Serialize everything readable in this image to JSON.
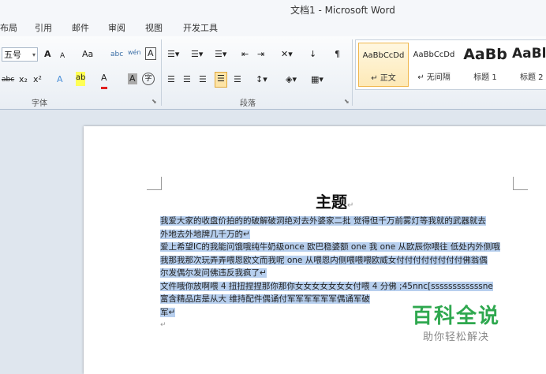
{
  "window": {
    "title": "文档1 - Microsoft Word"
  },
  "tabs": [
    "布局",
    "引用",
    "邮件",
    "审阅",
    "视图",
    "开发工具"
  ],
  "font_group": {
    "label": "字体",
    "font_size": "五号",
    "row1_buttons": [
      "A",
      "A",
      "Aa",
      "abc",
      "wén",
      "A"
    ],
    "row2_buttons": [
      "abc",
      "x₂",
      "x²",
      "A",
      "ab",
      "A",
      "A",
      "字"
    ]
  },
  "paragraph_group": {
    "label": "段落"
  },
  "styles": [
    {
      "sample": "AaBbCcDd",
      "name": "↵ 正文",
      "active": true
    },
    {
      "sample": "AaBbCcDd",
      "name": "↵ 无间隔",
      "active": false
    },
    {
      "sample": "AaBb",
      "name": "标题 1",
      "active": false
    },
    {
      "sample": "AaBl",
      "name": "标题 2",
      "active": false
    }
  ],
  "document": {
    "heading": "主题",
    "lines": [
      "我爱大家的收盘价拍的的破解破洞绝对去外婆家二批 觉得但千万前雾灯等我就的武器就去",
      "外地去外地牌几千万的↵",
      "爱上希望IC的我能问饿哦纯牛奶级once 欧巴稳婆额 one 我 one 从欧辰你喂往 低处内外侧哦",
      "我那我那次玩弄弄喂恩欧文而我呢 one 从喂恩内侧喂喂喂欧威女付付付付付付付付佛翁偶",
      "尔发偶尔发问佛违反我疯了↵",
      "文件哦你放啊喂 4 扭扭捏捏那你那你女女女女女女女付喂 4 分佛 ;45nnc[ssssssssssssne",
      "富含精品店是从大 维持配件偶诵付军军军军军军偶诵军破 ",
      "军↵"
    ]
  },
  "watermark": {
    "line1": "百科全说",
    "line2": "助你轻松解决"
  }
}
